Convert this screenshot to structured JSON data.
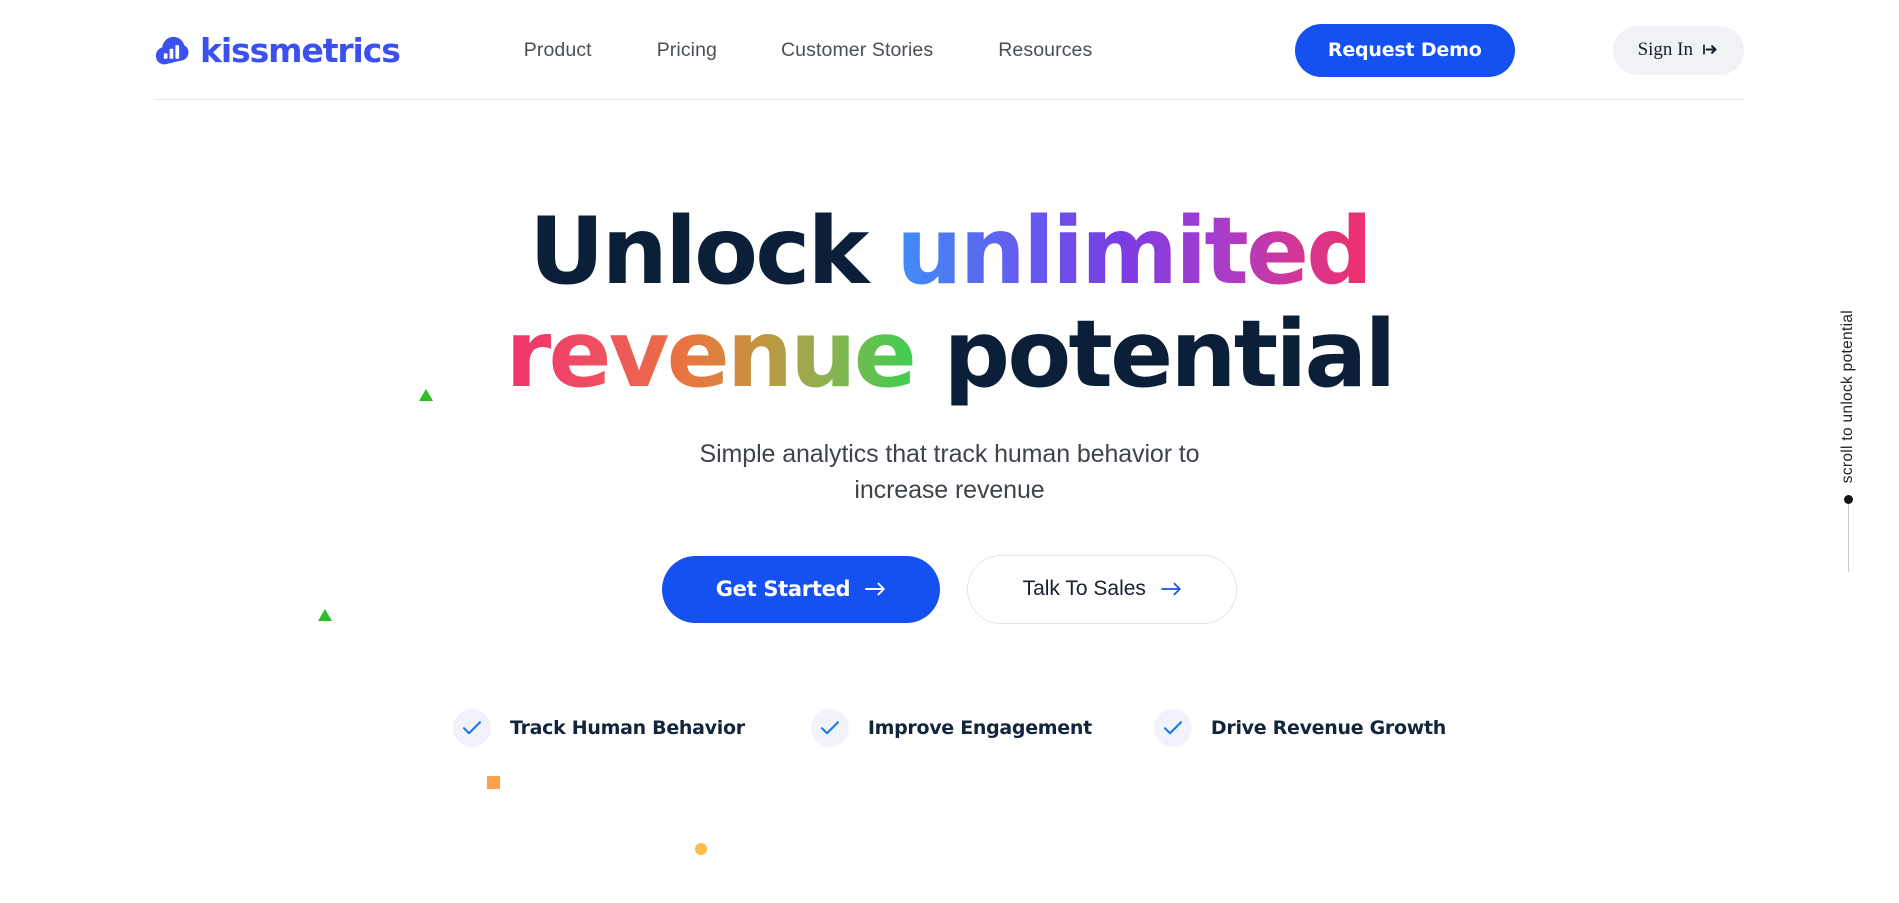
{
  "brand": {
    "name": "kissmetrics",
    "logo_icon": "cloud-bar-chart-icon",
    "color": "#3a50f0"
  },
  "header": {
    "nav": [
      {
        "label": "Product",
        "name": "product"
      },
      {
        "label": "Pricing",
        "name": "pricing"
      },
      {
        "label": "Customer Stories",
        "name": "customer-stories"
      },
      {
        "label": "Resources",
        "name": "resources"
      }
    ],
    "demo_button": {
      "label": "Request Demo",
      "bg": "#1550f0",
      "color": "#ffffff"
    },
    "signin_button": {
      "label": "Sign In",
      "icon": "login-arrow-icon",
      "bg": "#f0f2f5"
    }
  },
  "hero": {
    "headline": {
      "line1_plain": "Unlock ",
      "line1_gradient": "unlimited",
      "line2_gradient": "revenue",
      "line2_plain": " potential",
      "plain_color": "#0b2038",
      "gradient_unlimited": "#3f8ef7 → #7b3ce2 → #ef2f6c",
      "gradient_revenue": "#f0316b → #e8763f → #3ecf50"
    },
    "subheading": {
      "line1": "Simple analytics that track human behavior to",
      "line2": "increase revenue"
    },
    "cta": {
      "primary": {
        "label": "Get Started",
        "icon": "arrow-right-icon",
        "bg": "#1550f0"
      },
      "secondary": {
        "label": "Talk To Sales",
        "icon": "arrow-right-icon",
        "bg": "#ffffff"
      }
    },
    "features": [
      {
        "label": "Track Human Behavior",
        "icon": "check-icon"
      },
      {
        "label": "Improve Engagement",
        "icon": "check-icon"
      },
      {
        "label": "Drive Revenue Growth",
        "icon": "check-icon"
      }
    ],
    "decorations": [
      {
        "shape": "triangle",
        "color": "#2cbe27"
      },
      {
        "shape": "triangle",
        "color": "#2cbe27"
      },
      {
        "shape": "square",
        "color": "#ffa04a"
      },
      {
        "shape": "dot",
        "color": "#fcbb4a"
      }
    ]
  },
  "scroll_indicator": {
    "label": "scroll to unlock potential",
    "dot_color": "#111418"
  }
}
